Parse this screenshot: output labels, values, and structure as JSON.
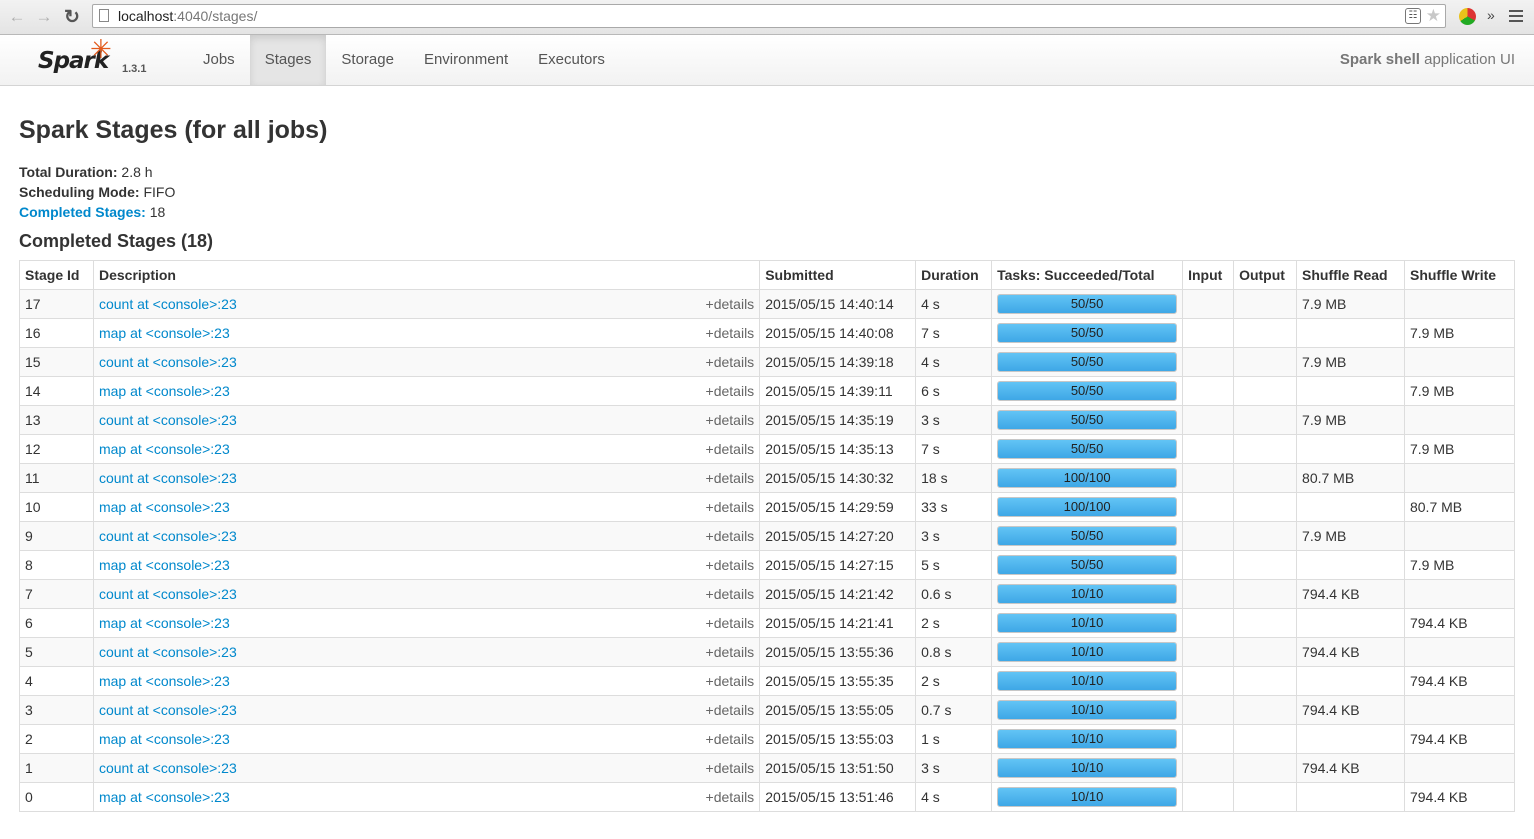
{
  "browser": {
    "url_host": "localhost",
    "url_path": ":4040/stages/"
  },
  "navbar": {
    "brand": "Spark",
    "version": "1.3.1",
    "tabs": [
      {
        "label": "Jobs",
        "active": false
      },
      {
        "label": "Stages",
        "active": true
      },
      {
        "label": "Storage",
        "active": false
      },
      {
        "label": "Environment",
        "active": false
      },
      {
        "label": "Executors",
        "active": false
      }
    ],
    "app_name": "Spark shell",
    "app_suffix": " application UI"
  },
  "page": {
    "title": "Spark Stages (for all jobs)",
    "total_duration_label": "Total Duration:",
    "total_duration": " 2.8 h",
    "scheduling_mode_label": "Scheduling Mode:",
    "scheduling_mode": " FIFO",
    "completed_stages_label": "Completed Stages:",
    "completed_stages": " 18",
    "section_title": "Completed Stages (18)"
  },
  "table": {
    "headers": [
      "Stage Id",
      "Description",
      "Submitted",
      "Duration",
      "Tasks: Succeeded/Total",
      "Input",
      "Output",
      "Shuffle Read",
      "Shuffle Write"
    ],
    "details_label": "+details",
    "rows": [
      {
        "id": "17",
        "desc": "count at <console>:23",
        "submitted": "2015/05/15 14:40:14",
        "duration": "4 s",
        "tasks": "50/50",
        "progress": 1.0,
        "input": "",
        "output": "",
        "shuffle_read": "7.9 MB",
        "shuffle_write": ""
      },
      {
        "id": "16",
        "desc": "map at <console>:23",
        "submitted": "2015/05/15 14:40:08",
        "duration": "7 s",
        "tasks": "50/50",
        "progress": 1.0,
        "input": "",
        "output": "",
        "shuffle_read": "",
        "shuffle_write": "7.9 MB"
      },
      {
        "id": "15",
        "desc": "count at <console>:23",
        "submitted": "2015/05/15 14:39:18",
        "duration": "4 s",
        "tasks": "50/50",
        "progress": 1.0,
        "input": "",
        "output": "",
        "shuffle_read": "7.9 MB",
        "shuffle_write": ""
      },
      {
        "id": "14",
        "desc": "map at <console>:23",
        "submitted": "2015/05/15 14:39:11",
        "duration": "6 s",
        "tasks": "50/50",
        "progress": 1.0,
        "input": "",
        "output": "",
        "shuffle_read": "",
        "shuffle_write": "7.9 MB"
      },
      {
        "id": "13",
        "desc": "count at <console>:23",
        "submitted": "2015/05/15 14:35:19",
        "duration": "3 s",
        "tasks": "50/50",
        "progress": 1.0,
        "input": "",
        "output": "",
        "shuffle_read": "7.9 MB",
        "shuffle_write": ""
      },
      {
        "id": "12",
        "desc": "map at <console>:23",
        "submitted": "2015/05/15 14:35:13",
        "duration": "7 s",
        "tasks": "50/50",
        "progress": 1.0,
        "input": "",
        "output": "",
        "shuffle_read": "",
        "shuffle_write": "7.9 MB"
      },
      {
        "id": "11",
        "desc": "count at <console>:23",
        "submitted": "2015/05/15 14:30:32",
        "duration": "18 s",
        "tasks": "100/100",
        "progress": 1.0,
        "input": "",
        "output": "",
        "shuffle_read": "80.7 MB",
        "shuffle_write": ""
      },
      {
        "id": "10",
        "desc": "map at <console>:23",
        "submitted": "2015/05/15 14:29:59",
        "duration": "33 s",
        "tasks": "100/100",
        "progress": 1.0,
        "input": "",
        "output": "",
        "shuffle_read": "",
        "shuffle_write": "80.7 MB"
      },
      {
        "id": "9",
        "desc": "count at <console>:23",
        "submitted": "2015/05/15 14:27:20",
        "duration": "3 s",
        "tasks": "50/50",
        "progress": 1.0,
        "input": "",
        "output": "",
        "shuffle_read": "7.9 MB",
        "shuffle_write": ""
      },
      {
        "id": "8",
        "desc": "map at <console>:23",
        "submitted": "2015/05/15 14:27:15",
        "duration": "5 s",
        "tasks": "50/50",
        "progress": 1.0,
        "input": "",
        "output": "",
        "shuffle_read": "",
        "shuffle_write": "7.9 MB"
      },
      {
        "id": "7",
        "desc": "count at <console>:23",
        "submitted": "2015/05/15 14:21:42",
        "duration": "0.6 s",
        "tasks": "10/10",
        "progress": 1.0,
        "input": "",
        "output": "",
        "shuffle_read": "794.4 KB",
        "shuffle_write": ""
      },
      {
        "id": "6",
        "desc": "map at <console>:23",
        "submitted": "2015/05/15 14:21:41",
        "duration": "2 s",
        "tasks": "10/10",
        "progress": 1.0,
        "input": "",
        "output": "",
        "shuffle_read": "",
        "shuffle_write": "794.4 KB"
      },
      {
        "id": "5",
        "desc": "count at <console>:23",
        "submitted": "2015/05/15 13:55:36",
        "duration": "0.8 s",
        "tasks": "10/10",
        "progress": 1.0,
        "input": "",
        "output": "",
        "shuffle_read": "794.4 KB",
        "shuffle_write": ""
      },
      {
        "id": "4",
        "desc": "map at <console>:23",
        "submitted": "2015/05/15 13:55:35",
        "duration": "2 s",
        "tasks": "10/10",
        "progress": 1.0,
        "input": "",
        "output": "",
        "shuffle_read": "",
        "shuffle_write": "794.4 KB"
      },
      {
        "id": "3",
        "desc": "count at <console>:23",
        "submitted": "2015/05/15 13:55:05",
        "duration": "0.7 s",
        "tasks": "10/10",
        "progress": 1.0,
        "input": "",
        "output": "",
        "shuffle_read": "794.4 KB",
        "shuffle_write": ""
      },
      {
        "id": "2",
        "desc": "map at <console>:23",
        "submitted": "2015/05/15 13:55:03",
        "duration": "1 s",
        "tasks": "10/10",
        "progress": 1.0,
        "input": "",
        "output": "",
        "shuffle_read": "",
        "shuffle_write": "794.4 KB"
      },
      {
        "id": "1",
        "desc": "count at <console>:23",
        "submitted": "2015/05/15 13:51:50",
        "duration": "3 s",
        "tasks": "10/10",
        "progress": 1.0,
        "input": "",
        "output": "",
        "shuffle_read": "794.4 KB",
        "shuffle_write": ""
      },
      {
        "id": "0",
        "desc": "map at <console>:23",
        "submitted": "2015/05/15 13:51:46",
        "duration": "4 s",
        "tasks": "10/10",
        "progress": 1.0,
        "input": "",
        "output": "",
        "shuffle_read": "",
        "shuffle_write": "794.4 KB"
      }
    ]
  },
  "colors": {
    "link": "#0088cc",
    "progress_bar": "#3ea7e6",
    "spark_orange": "#e25a1c"
  },
  "icons": {
    "back": "arrow-left-icon",
    "forward": "arrow-right-icon",
    "reload": "reload-icon",
    "translate": "translate-icon",
    "bookmark": "star-icon",
    "extension": "extension-icon",
    "overflow": "chevron-double-right-icon",
    "menu": "hamburger-menu-icon"
  }
}
